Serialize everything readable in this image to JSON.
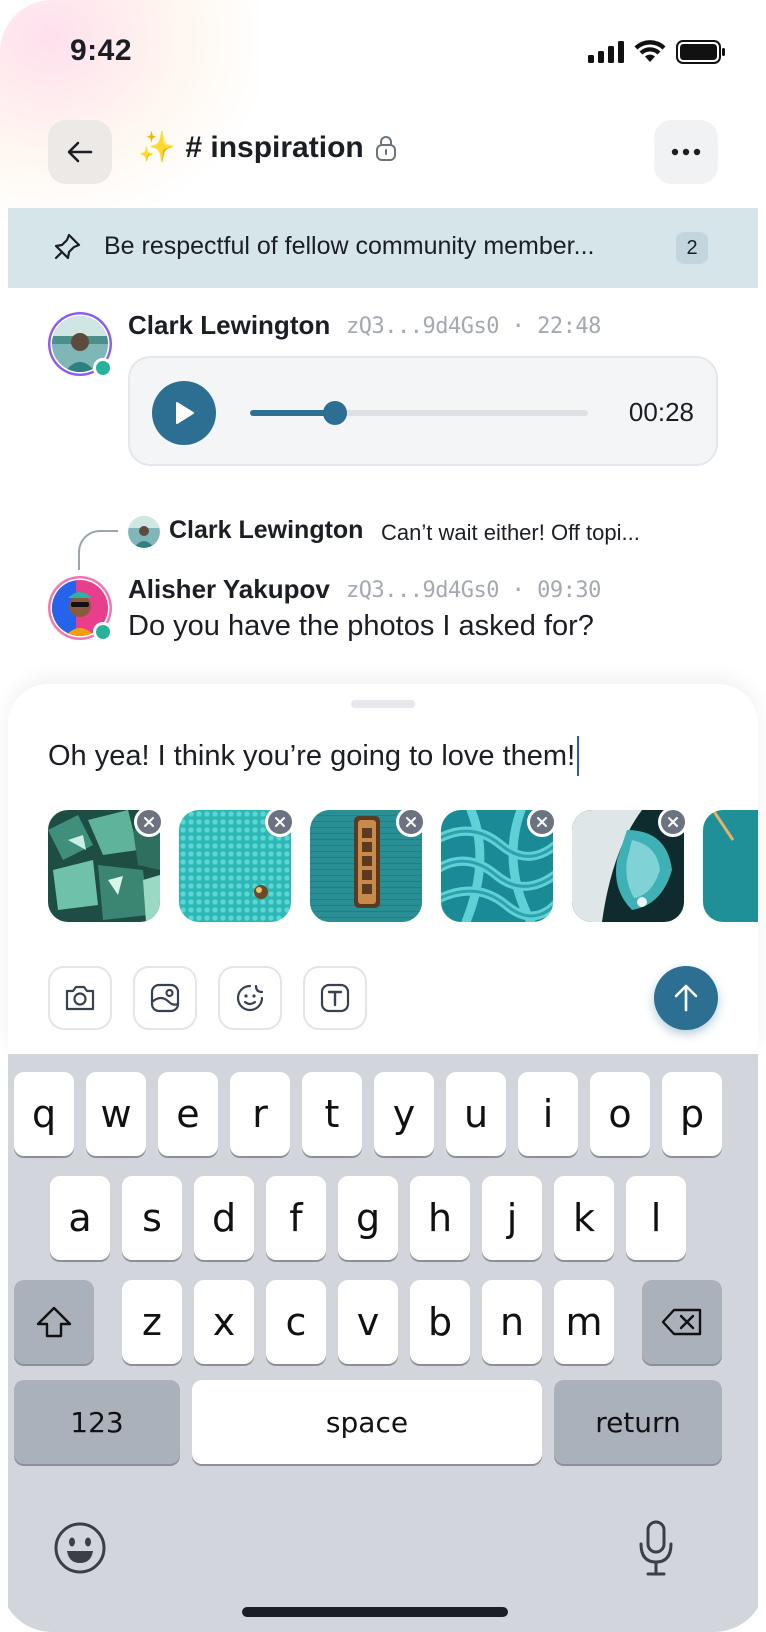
{
  "status_bar": {
    "time": "9:42"
  },
  "header": {
    "emoji": "✨",
    "channel": "# inspiration"
  },
  "pinned": {
    "text": "Be respectful of fellow community member...",
    "count": "2"
  },
  "messages": [
    {
      "author": "Clark Lewington",
      "meta": "zQ3...9d4Gs0 · 22:48",
      "audio_duration": "00:28",
      "audio_progress": 0.25
    },
    {
      "author": "Alisher Yakupov",
      "meta": "zQ3...9d4Gs0 · 09:30",
      "text": "Do you have the photos I asked for?",
      "reply": {
        "author": "Clark Lewington",
        "text": "Can’t wait either! Off topi..."
      }
    }
  ],
  "composer": {
    "text": "Oh yea! I think you’re going to love them!",
    "attachments": [
      "gemstones",
      "beads",
      "coffee-sign",
      "rope",
      "flower",
      "teal-fabric"
    ]
  },
  "keyboard": {
    "row1": [
      "q",
      "w",
      "e",
      "r",
      "t",
      "y",
      "u",
      "i",
      "o",
      "p"
    ],
    "row2": [
      "a",
      "s",
      "d",
      "f",
      "g",
      "h",
      "j",
      "k",
      "l"
    ],
    "row3": [
      "z",
      "x",
      "c",
      "v",
      "b",
      "n",
      "m"
    ],
    "numbers": "123",
    "space": "space",
    "return": "return"
  },
  "colors": {
    "accent": "#2c6f92",
    "pinned_bg": "#d6e5ea",
    "online": "#27b39a"
  }
}
